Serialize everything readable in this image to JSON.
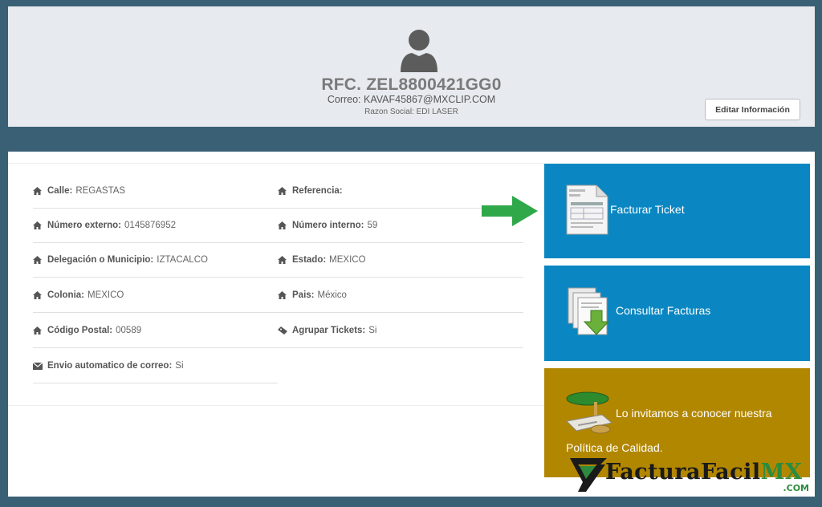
{
  "profile": {
    "rfc": "RFC. ZEL8800421GG0",
    "correo": "Correo: KAVAF45867@MXCLIP.COM",
    "razon_social": "Razon Social: EDI LASER",
    "edit_label": "Editar Información"
  },
  "fields": {
    "calle": {
      "label": "Calle:",
      "value": "REGASTAS"
    },
    "referencia": {
      "label": "Referencia:",
      "value": ""
    },
    "num_ext": {
      "label": "Número externo:",
      "value": "0145876952"
    },
    "num_int": {
      "label": "Número interno:",
      "value": "59"
    },
    "delegacion": {
      "label": "Delegación o Municipio:",
      "value": "IZTACALCO"
    },
    "estado": {
      "label": "Estado:",
      "value": "MEXICO"
    },
    "colonia": {
      "label": "Colonia:",
      "value": "MEXICO"
    },
    "pais": {
      "label": "Pais:",
      "value": "México"
    },
    "cp": {
      "label": "Código Postal:",
      "value": "00589"
    },
    "agrupar": {
      "label": "Agrupar Tickets:",
      "value": "Si"
    },
    "envio": {
      "label": "Envio automatico de correo:",
      "value": "Si"
    }
  },
  "tiles": {
    "facturar": "Facturar Ticket",
    "consultar": "Consultar Facturas",
    "politica_line1": "Lo invitamos a conocer nuestra",
    "politica_line2": "Política de Calidad."
  },
  "logo": {
    "name_main": "FacturaFacil",
    "name_accent": "MX",
    "suffix": ".COM"
  },
  "icons": {
    "avatar": "user-icon",
    "field": "home-icon",
    "agrupar": "ticket-icon",
    "envio": "envelope-icon"
  },
  "colors": {
    "background": "#3a6075",
    "tile_blue": "#0a87c2",
    "tile_gold": "#b28700",
    "arrow": "#2fa84a"
  }
}
